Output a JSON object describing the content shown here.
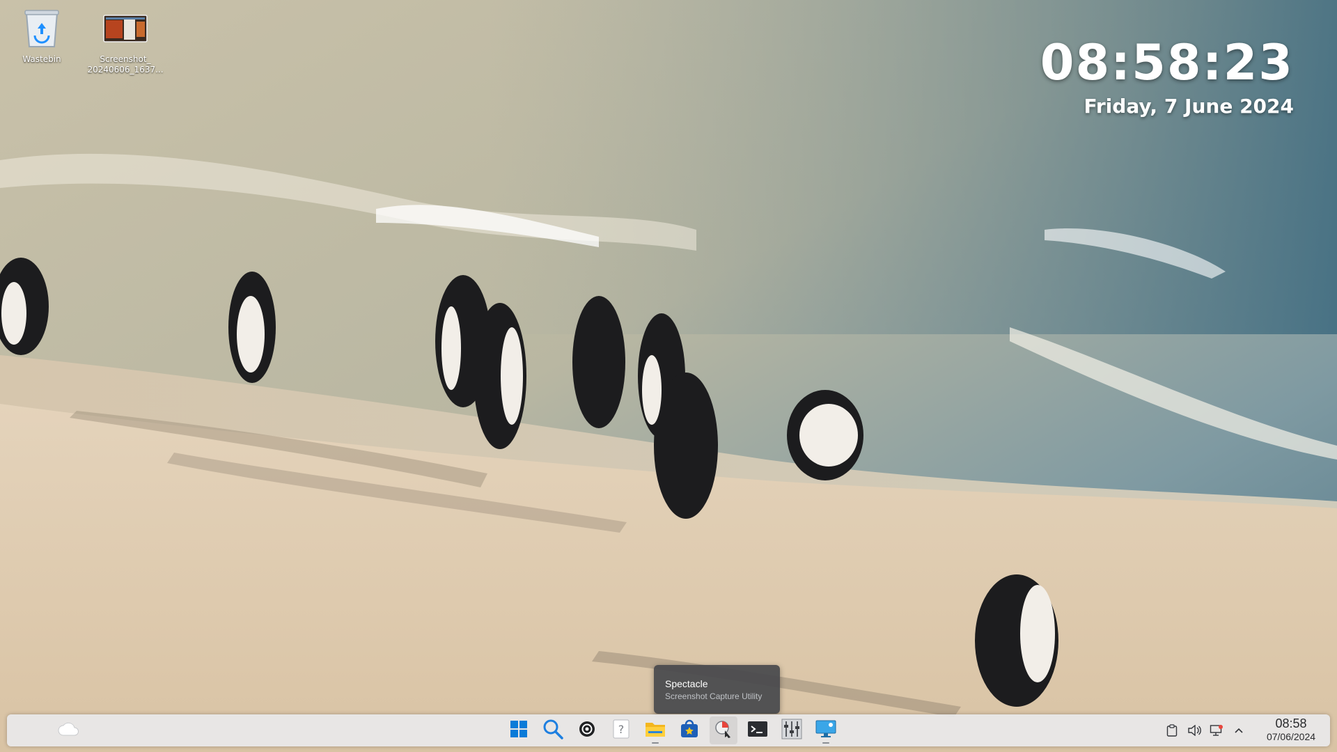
{
  "desktop": {
    "icons": [
      {
        "label": "Wastebin",
        "icon": "wastebin-icon"
      },
      {
        "label": "Screenshot_\n20240606_1637...",
        "icon": "image-file-icon"
      }
    ]
  },
  "clock_widget": {
    "time": "08:58:23",
    "date": "Friday, 7 June 2024"
  },
  "tooltip": {
    "title": "Spectacle",
    "subtitle": "Screenshot Capture Utility"
  },
  "taskbar": {
    "weather_icon": "cloud-icon",
    "apps": [
      {
        "name": "Application Launcher",
        "icon": "windows-start-icon"
      },
      {
        "name": "Search",
        "icon": "search-icon"
      },
      {
        "name": "ChatGPT",
        "icon": "openai-icon"
      },
      {
        "name": "Help",
        "icon": "help-icon"
      },
      {
        "name": "File Manager",
        "icon": "folder-icon"
      },
      {
        "name": "Discover",
        "icon": "store-bag-icon"
      },
      {
        "name": "Spectacle",
        "icon": "spectacle-icon"
      },
      {
        "name": "Terminal",
        "icon": "terminal-icon"
      },
      {
        "name": "System Monitor",
        "icon": "system-monitor-icon"
      },
      {
        "name": "Remote Desktop",
        "icon": "remote-desktop-icon"
      }
    ],
    "tray": [
      "clipboard-icon",
      "volume-icon",
      "network-icon",
      "expand-up-icon"
    ],
    "clock_time": "08:58",
    "clock_date": "07/06/2024"
  },
  "colors": {
    "taskbar_bg": "#e8e8ea",
    "tooltip_bg": "#46484c",
    "accent_blue": "#1e90ff"
  }
}
